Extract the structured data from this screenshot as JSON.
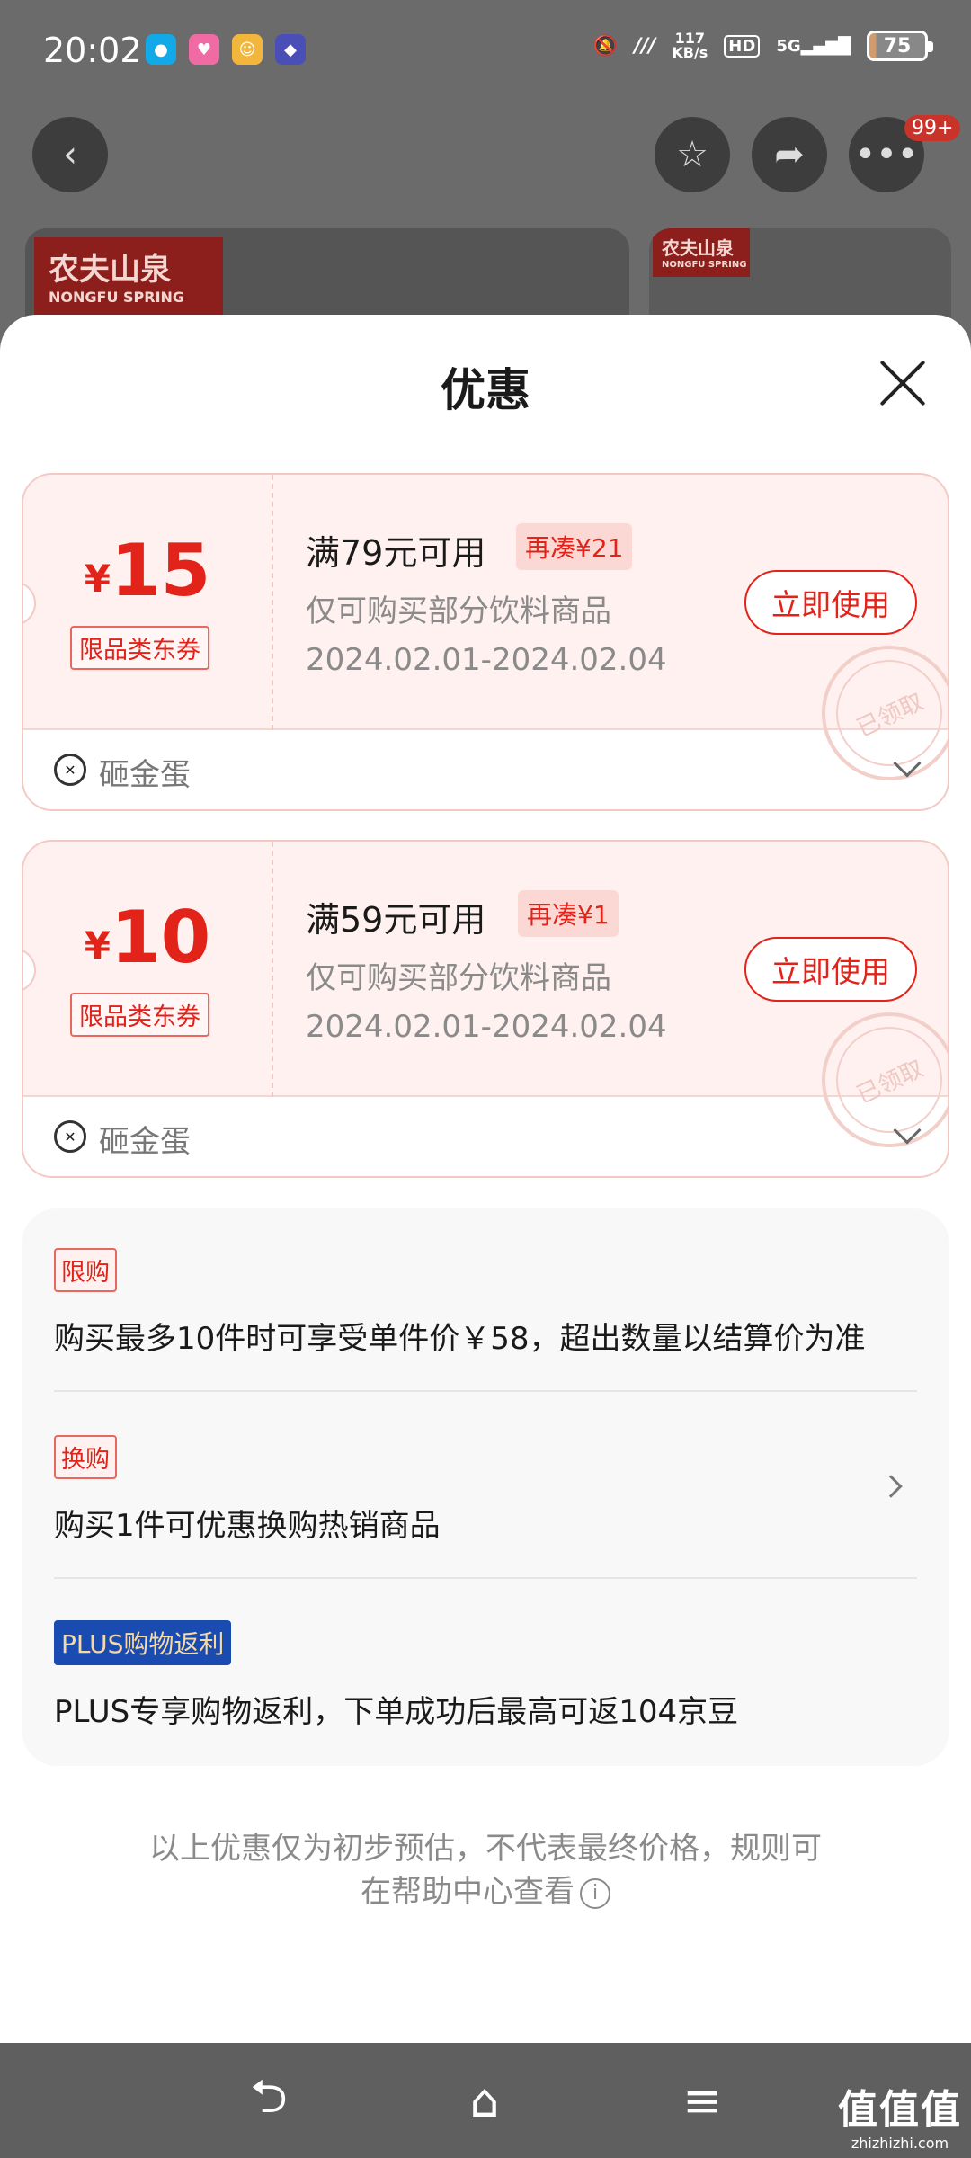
{
  "status_bar": {
    "time": "20:02",
    "net_speed_value": "117",
    "net_speed_unit": "KB/s",
    "hd_label": "HD",
    "signal_label": "5G",
    "battery": "75"
  },
  "background_page": {
    "more_badge": "99+",
    "brand_logo_line1": "农夫山泉",
    "brand_logo_line2": "NONGFU SPRING"
  },
  "sheet": {
    "title": "优惠",
    "coupons": [
      {
        "currency": "¥",
        "amount": "15",
        "type_tag": "限品类东券",
        "condition": "满79元可用",
        "extra_tag": "再凑¥21",
        "description": "仅可购买部分饮料商品",
        "validity": "2024.02.01-2024.02.04",
        "button": "立即使用",
        "stamp": "已领取",
        "source": "砸金蛋"
      },
      {
        "currency": "¥",
        "amount": "10",
        "type_tag": "限品类东券",
        "condition": "满59元可用",
        "extra_tag": "再凑¥1",
        "description": "仅可购买部分饮料商品",
        "validity": "2024.02.01-2024.02.04",
        "button": "立即使用",
        "stamp": "已领取",
        "source": "砸金蛋"
      }
    ],
    "promotions": [
      {
        "tag": "限购",
        "text": "购买最多10件时可享受单件价￥58，超出数量以结算价为准"
      },
      {
        "tag": "换购",
        "text": "购买1件可优惠换购热销商品"
      },
      {
        "tag": "PLUS购物返利",
        "text": "PLUS专享购物返利，下单成功后最高可返104京豆"
      }
    ],
    "disclaimer_line1": "以上优惠仅为初步预估，不代表最终价格，规则可",
    "disclaimer_line2": "在帮助中心查看"
  },
  "watermark": {
    "main": "值值值",
    "sub": "zhizhizhi.com"
  },
  "colors": {
    "accent": "#e2231a",
    "coupon_bg": "#fff1ef",
    "plus_tag": "#1a4bb0"
  }
}
